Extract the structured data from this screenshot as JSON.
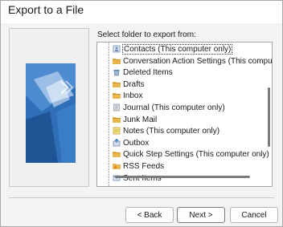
{
  "window": {
    "title": "Export to a File"
  },
  "main": {
    "select_label": "Select folder to export from:"
  },
  "folders": [
    {
      "label": "Contacts (This computer only)",
      "icon": "contacts-icon"
    },
    {
      "label": "Conversation Action Settings (This compu",
      "icon": "folder-icon"
    },
    {
      "label": "Deleted Items",
      "icon": "recycle-icon"
    },
    {
      "label": "Drafts",
      "icon": "folder-icon"
    },
    {
      "label": "Inbox",
      "icon": "folder-icon"
    },
    {
      "label": "Journal (This computer only)",
      "icon": "journal-icon"
    },
    {
      "label": "Junk Mail",
      "icon": "folder-icon"
    },
    {
      "label": "Notes (This computer only)",
      "icon": "notes-icon"
    },
    {
      "label": "Outbox",
      "icon": "outbox-icon"
    },
    {
      "label": "Quick Step Settings (This computer only)",
      "icon": "folder-icon"
    },
    {
      "label": "RSS Feeds",
      "icon": "rss-icon"
    },
    {
      "label": "Sent Items",
      "icon": "sent-icon"
    }
  ],
  "buttons": {
    "back": "< Back",
    "next": "Next >",
    "cancel": "Cancel"
  },
  "colors": {
    "folder": "#e8b64c",
    "art_blue": "#2e6fb8",
    "art_light": "#a9c7ea"
  }
}
